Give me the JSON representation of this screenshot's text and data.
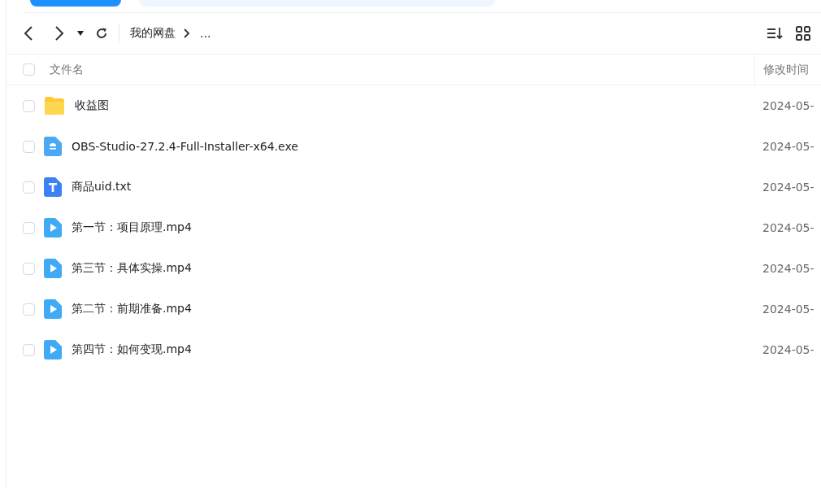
{
  "toolbar": {
    "breadcrumb": [
      {
        "label": "我的网盘"
      },
      {
        "label": "..."
      }
    ]
  },
  "table": {
    "select_all": {
      "checked": false
    },
    "columns": [
      "文件名",
      "修改时间"
    ],
    "rows": [
      {
        "kind": "folder",
        "name": "收益图",
        "modified": "2024-05-",
        "checked": false
      },
      {
        "kind": "exe",
        "name": "OBS-Studio-27.2.4-Full-Installer-x64.exe",
        "modified": "2024-05-",
        "checked": false
      },
      {
        "kind": "txt",
        "name": "商品uid.txt",
        "modified": "2024-05-",
        "checked": false
      },
      {
        "kind": "video",
        "name": "第一节：项目原理.mp4",
        "modified": "2024-05-",
        "checked": false
      },
      {
        "kind": "video",
        "name": "第三节：具体实操.mp4",
        "modified": "2024-05-",
        "checked": false
      },
      {
        "kind": "video",
        "name": "第二节：前期准备.mp4",
        "modified": "2024-05-",
        "checked": false
      },
      {
        "kind": "video",
        "name": "第四节：如何变现.mp4",
        "modified": "2024-05-",
        "checked": false
      }
    ]
  }
}
